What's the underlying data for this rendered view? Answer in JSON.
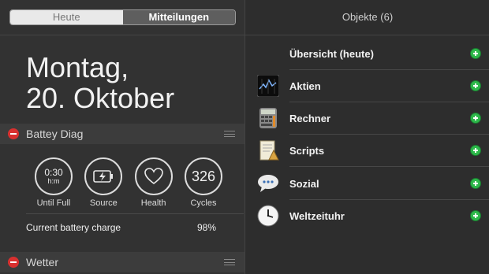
{
  "tabs": {
    "heute": "Heute",
    "mitteilungen": "Mitteilungen"
  },
  "date": {
    "day": "Montag,",
    "date": "20. Oktober"
  },
  "battery_widget": {
    "title": "Battey Diag",
    "items": [
      {
        "value": "0:30",
        "unit": "h:m",
        "label": "Until Full"
      },
      {
        "value": "",
        "unit": "",
        "label": "Source"
      },
      {
        "value": "",
        "unit": "",
        "label": "Health"
      },
      {
        "value": "326",
        "unit": "",
        "label": "Cycles"
      }
    ],
    "charge_label": "Current battery charge",
    "charge_value": "98%"
  },
  "weather_widget": {
    "title": "Wetter"
  },
  "objects": {
    "title": "Objekte (6)",
    "items": [
      {
        "label": "Übersicht (heute)",
        "icon": "none"
      },
      {
        "label": "Aktien",
        "icon": "stocks-icon"
      },
      {
        "label": "Rechner",
        "icon": "calculator-icon"
      },
      {
        "label": "Scripts",
        "icon": "scripts-icon"
      },
      {
        "label": "Sozial",
        "icon": "speech-bubble-icon"
      },
      {
        "label": "Weltzeituhr",
        "icon": "clock-icon"
      }
    ]
  },
  "colors": {
    "remove": "#d9302f",
    "add": "#2db84a"
  }
}
